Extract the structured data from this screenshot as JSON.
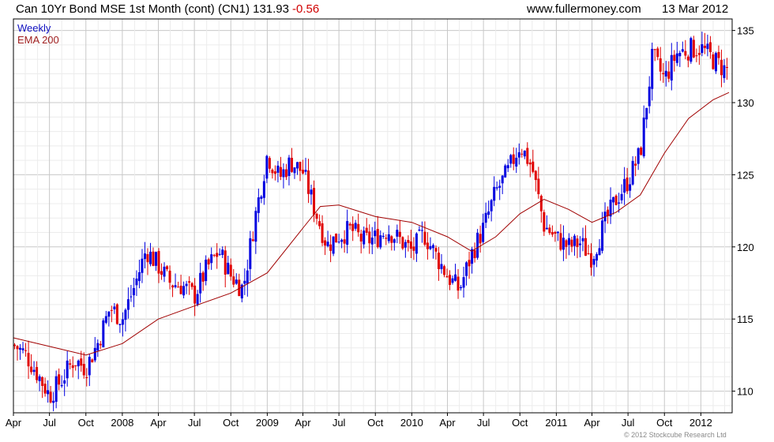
{
  "header": {
    "title": "Can 10Yr Bond MSE 1st Month (cont) (CN1) 131.93",
    "change": "-0.56",
    "site": "www.fullermoney.com",
    "date": "13 Mar 2012"
  },
  "legend": {
    "weekly": "Weekly",
    "ema": "EMA 200"
  },
  "copyright": "© 2012 Stockcube Research Ltd",
  "colors": {
    "up": "#0000e0",
    "down": "#e00000",
    "ema": "#a00000",
    "grid": "#dcdcdc"
  },
  "chart_data": {
    "type": "candlestick",
    "title": "Can 10Yr Bond MSE 1st Month (cont) (CN1) 131.93 -0.56",
    "y_axis": {
      "ticks": [
        110,
        115,
        120,
        125,
        130,
        135
      ],
      "ylim": [
        108.5,
        135.8
      ],
      "side": "right"
    },
    "x_axis": {
      "ticks": [
        "Apr",
        "Jul",
        "Oct",
        "2008",
        "Apr",
        "Jul",
        "Oct",
        "2009",
        "Apr",
        "Jul",
        "Oct",
        "2010",
        "Apr",
        "Jul",
        "Oct",
        "2011",
        "Apr",
        "Jul",
        "Oct",
        "2012"
      ],
      "xlim": [
        "2007-04-01",
        "2012-03-20"
      ]
    },
    "grid": true,
    "series": [
      {
        "name": "Weekly",
        "kind": "close",
        "points": [
          [
            "2007-04-01",
            113.2
          ],
          [
            "2007-05-01",
            112.6
          ],
          [
            "2007-06-01",
            111.2
          ],
          [
            "2007-07-01",
            109.7
          ],
          [
            "2007-08-01",
            110.8
          ],
          [
            "2007-09-01",
            112.2
          ],
          [
            "2007-10-01",
            111.6
          ],
          [
            "2007-11-01",
            113.4
          ],
          [
            "2007-12-01",
            115.8
          ],
          [
            "2008-01-01",
            115.0
          ],
          [
            "2008-02-01",
            117.3
          ],
          [
            "2008-03-01",
            119.8
          ],
          [
            "2008-04-01",
            118.7
          ],
          [
            "2008-05-01",
            117.5
          ],
          [
            "2008-06-01",
            117.3
          ],
          [
            "2008-07-01",
            116.6
          ],
          [
            "2008-08-01",
            118.5
          ],
          [
            "2008-09-01",
            119.7
          ],
          [
            "2008-10-01",
            118.0
          ],
          [
            "2008-11-01",
            117.1
          ],
          [
            "2008-12-01",
            122.0
          ],
          [
            "2009-01-01",
            126.4
          ],
          [
            "2009-02-01",
            124.8
          ],
          [
            "2009-03-01",
            125.9
          ],
          [
            "2009-04-01",
            125.2
          ],
          [
            "2009-05-01",
            122.6
          ],
          [
            "2009-06-01",
            120.1
          ],
          [
            "2009-07-01",
            120.8
          ],
          [
            "2009-08-01",
            121.2
          ],
          [
            "2009-09-01",
            120.4
          ],
          [
            "2009-10-01",
            120.6
          ],
          [
            "2009-11-01",
            121.2
          ],
          [
            "2009-12-01",
            120.5
          ],
          [
            "2010-01-01",
            119.7
          ],
          [
            "2010-02-01",
            120.9
          ],
          [
            "2010-03-01",
            119.5
          ],
          [
            "2010-04-01",
            118.0
          ],
          [
            "2010-05-01",
            117.0
          ],
          [
            "2010-06-01",
            119.5
          ],
          [
            "2010-07-01",
            121.3
          ],
          [
            "2010-08-01",
            123.8
          ],
          [
            "2010-09-01",
            125.2
          ],
          [
            "2010-10-01",
            127.1
          ],
          [
            "2010-11-01",
            125.5
          ],
          [
            "2010-12-01",
            121.5
          ],
          [
            "2011-01-01",
            120.6
          ],
          [
            "2011-02-01",
            120.0
          ],
          [
            "2011-03-01",
            120.3
          ],
          [
            "2011-04-01",
            119.3
          ],
          [
            "2011-05-01",
            121.5
          ],
          [
            "2011-06-01",
            123.3
          ],
          [
            "2011-07-01",
            124.6
          ],
          [
            "2011-08-01",
            126.5
          ],
          [
            "2011-09-01",
            133.2
          ],
          [
            "2011-10-01",
            131.6
          ],
          [
            "2011-11-01",
            133.4
          ],
          [
            "2011-12-01",
            133.7
          ],
          [
            "2012-01-01",
            133.8
          ],
          [
            "2012-02-01",
            133.0
          ],
          [
            "2012-03-01",
            132.3
          ]
        ]
      },
      {
        "name": "EMA 200",
        "points": [
          [
            "2007-04-01",
            113.7
          ],
          [
            "2007-07-01",
            113.1
          ],
          [
            "2007-10-01",
            112.5
          ],
          [
            "2008-01-01",
            113.3
          ],
          [
            "2008-04-01",
            115.0
          ],
          [
            "2008-07-01",
            115.9
          ],
          [
            "2008-10-01",
            116.8
          ],
          [
            "2009-01-01",
            118.2
          ],
          [
            "2009-04-01",
            121.3
          ],
          [
            "2009-05-15",
            122.8
          ],
          [
            "2009-07-01",
            122.9
          ],
          [
            "2009-10-01",
            122.1
          ],
          [
            "2010-01-01",
            121.7
          ],
          [
            "2010-04-01",
            120.7
          ],
          [
            "2010-06-01",
            119.7
          ],
          [
            "2010-08-01",
            120.7
          ],
          [
            "2010-10-01",
            122.3
          ],
          [
            "2010-12-01",
            123.3
          ],
          [
            "2011-02-01",
            122.6
          ],
          [
            "2011-04-01",
            121.7
          ],
          [
            "2011-06-01",
            122.4
          ],
          [
            "2011-08-01",
            123.6
          ],
          [
            "2011-10-01",
            126.5
          ],
          [
            "2011-12-01",
            128.9
          ],
          [
            "2012-02-01",
            130.2
          ],
          [
            "2012-03-12",
            130.7
          ]
        ]
      }
    ]
  }
}
